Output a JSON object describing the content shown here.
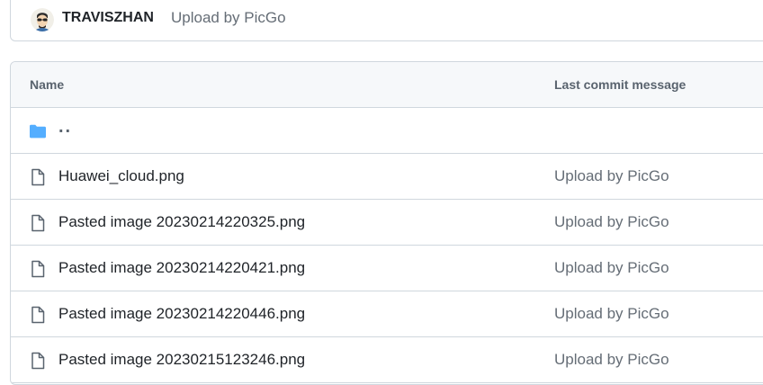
{
  "latest_commit": {
    "author": "TRAVISZHAN",
    "message": "Upload by PicGo"
  },
  "table": {
    "headers": {
      "name": "Name",
      "last_commit_message": "Last commit message"
    },
    "parent_dir": {
      "name": "..",
      "icon": "folder-icon",
      "icon_color": "#54aeff"
    },
    "rows": [
      {
        "name": "Huawei_cloud.png",
        "message": "Upload by PicGo",
        "icon": "file-icon"
      },
      {
        "name": "Pasted image 20230214220325.png",
        "message": "Upload by PicGo",
        "icon": "file-icon"
      },
      {
        "name": "Pasted image 20230214220421.png",
        "message": "Upload by PicGo",
        "icon": "file-icon"
      },
      {
        "name": "Pasted image 20230214220446.png",
        "message": "Upload by PicGo",
        "icon": "file-icon"
      },
      {
        "name": "Pasted image 20230215123246.png",
        "message": "Upload by PicGo",
        "icon": "file-icon"
      }
    ]
  },
  "colors": {
    "border": "#d0d7de",
    "header_bg": "#f6f8fa",
    "muted_text": "#656d76",
    "folder": "#54aeff"
  }
}
